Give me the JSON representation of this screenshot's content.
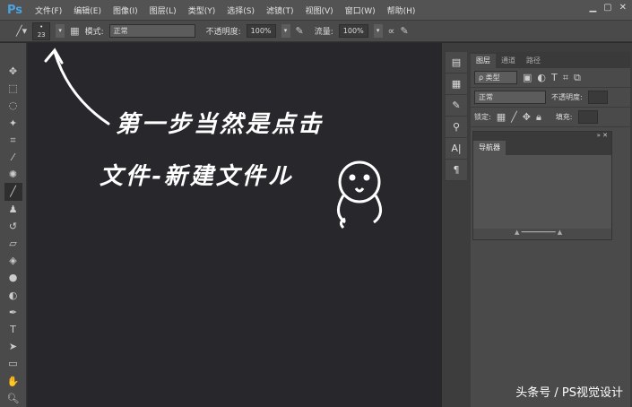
{
  "app": {
    "logo": "Ps"
  },
  "menu": [
    "文件(F)",
    "编辑(E)",
    "图像(I)",
    "图层(L)",
    "类型(Y)",
    "选择(S)",
    "滤镜(T)",
    "视图(V)",
    "窗口(W)",
    "帮助(H)"
  ],
  "options": {
    "brush_size": "23",
    "mode_label": "模式:",
    "mode_value": "正常",
    "opacity_label": "不透明度:",
    "opacity_value": "100%",
    "flow_label": "流量:",
    "flow_value": "100%"
  },
  "layers_panel": {
    "tabs": [
      "图层",
      "通道",
      "路径"
    ],
    "filter": "ρ 类型",
    "blend": "正常",
    "opacity_label": "不透明度:",
    "lock_label": "锁定:",
    "fill_label": "填充:"
  },
  "navigator": {
    "title": "导航器"
  },
  "annotation": {
    "line1": "第一步当然是点击",
    "line2": "文件-新建文件ル"
  },
  "watermark": "头条号 / PS视觉设计"
}
